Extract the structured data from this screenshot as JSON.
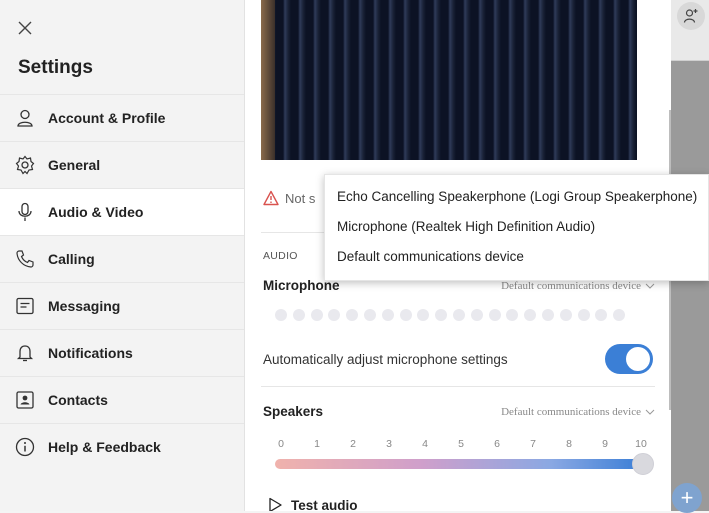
{
  "sidebar": {
    "title": "Settings",
    "items": [
      {
        "label": "Account & Profile",
        "icon": "person-icon"
      },
      {
        "label": "General",
        "icon": "gear-icon"
      },
      {
        "label": "Audio & Video",
        "icon": "microphone-icon"
      },
      {
        "label": "Calling",
        "icon": "phone-icon"
      },
      {
        "label": "Messaging",
        "icon": "message-icon"
      },
      {
        "label": "Notifications",
        "icon": "bell-icon"
      },
      {
        "label": "Contacts",
        "icon": "contact-card-icon"
      },
      {
        "label": "Help & Feedback",
        "icon": "info-icon"
      }
    ],
    "active_index": 2
  },
  "main": {
    "warning_text": "Not s",
    "audio_heading": "AUDIO",
    "microphone": {
      "label": "Microphone",
      "device": "Default communications device"
    },
    "auto_adjust": {
      "label": "Automatically adjust microphone settings",
      "enabled": true
    },
    "speakers": {
      "label": "Speakers",
      "device": "Default communications device",
      "ticks": [
        "0",
        "1",
        "2",
        "3",
        "4",
        "5",
        "6",
        "7",
        "8",
        "9",
        "10"
      ],
      "volume": 10
    },
    "test_audio": "Test audio"
  },
  "dropdown": {
    "options": [
      "Echo Cancelling Speakerphone (Logi Group Speakerphone)",
      "Microphone (Realtek High Definition Audio)",
      "Default communications device"
    ]
  },
  "colors": {
    "accent": "#3b7fd6",
    "warning": "#d9534f"
  }
}
